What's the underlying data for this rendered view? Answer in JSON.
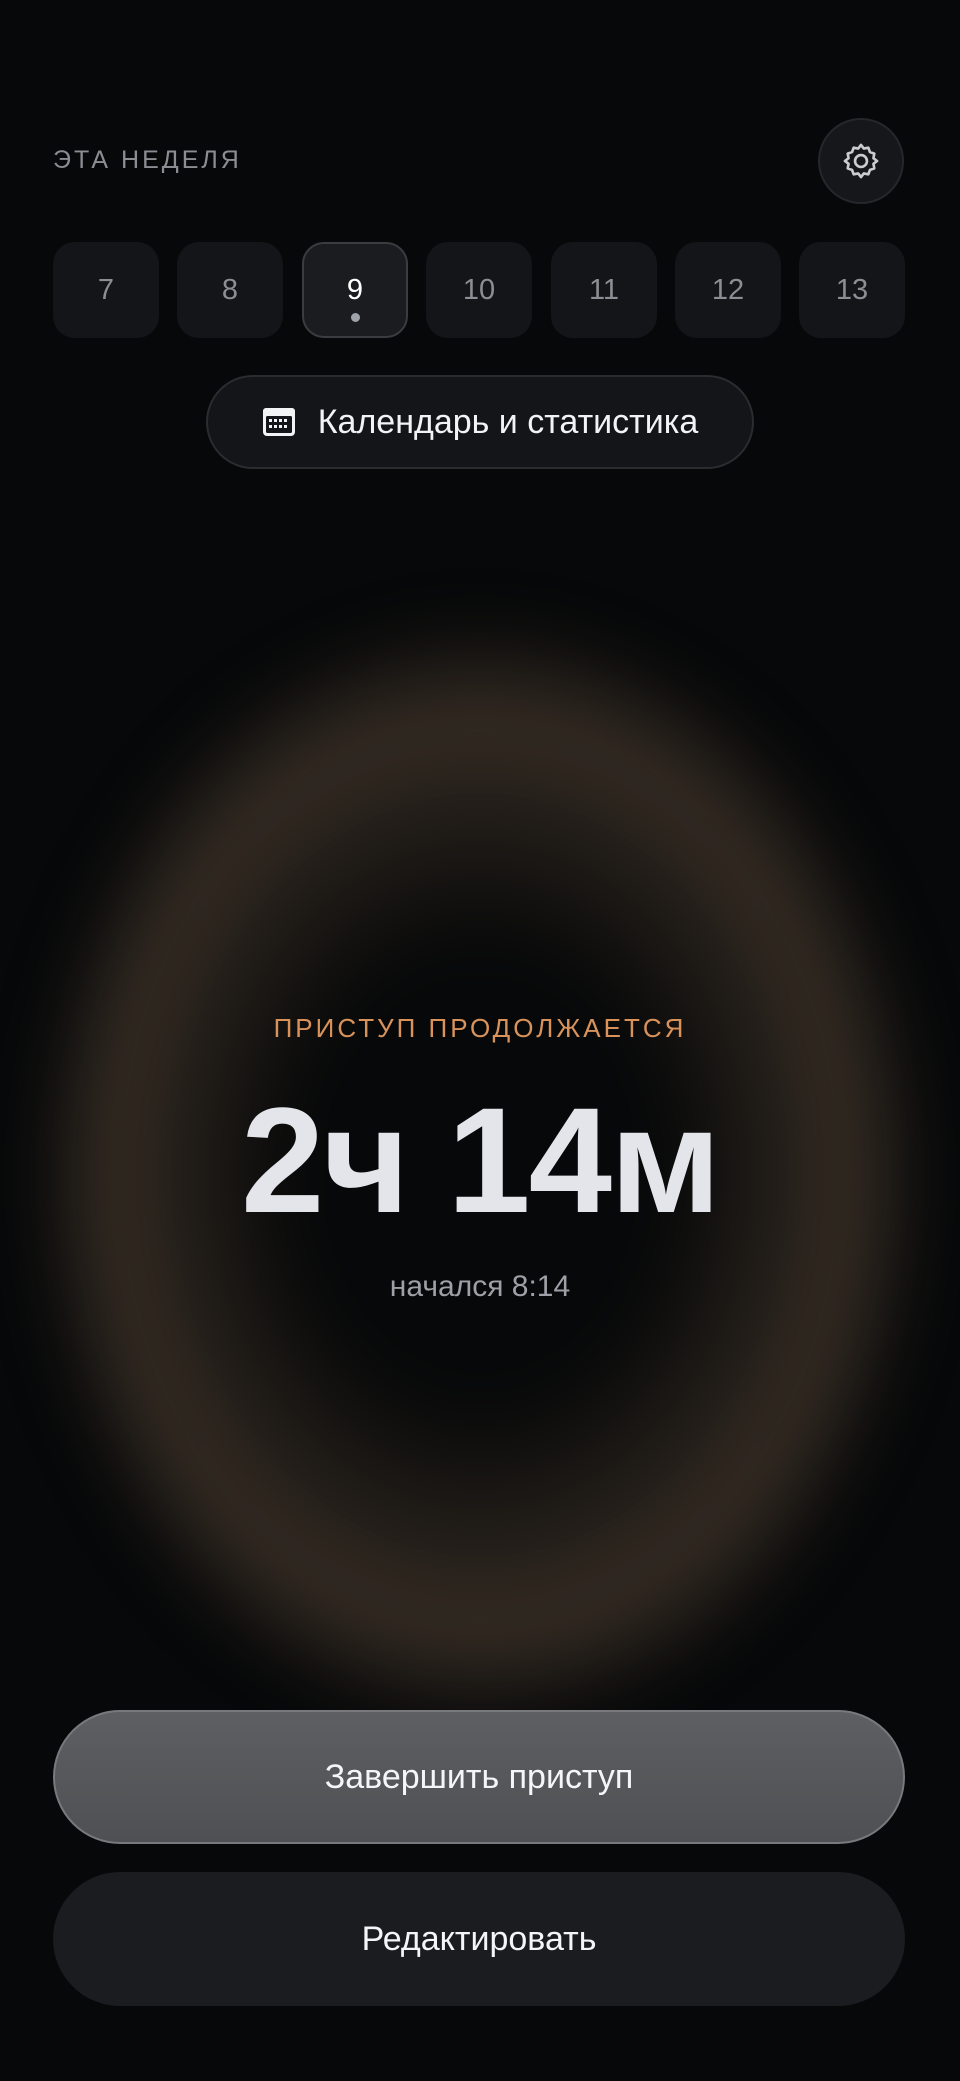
{
  "header": {
    "week_label": "ЭТА НЕДЕЛЯ",
    "settings_icon": "gear-icon"
  },
  "week": {
    "days": [
      "7",
      "8",
      "9",
      "10",
      "11",
      "12",
      "13"
    ],
    "selected_index": 2
  },
  "calendar_button": {
    "icon": "calendar-icon",
    "label": "Календарь и статистика"
  },
  "episode": {
    "status": "ПРИСТУП ПРОДОЛЖАЕТСЯ",
    "duration": "2ч 14м",
    "started": "начался 8:14"
  },
  "actions": {
    "end_label": "Завершить приступ",
    "edit_label": "Редактировать"
  },
  "colors": {
    "background": "#070809",
    "accent": "#d9935a",
    "primary_button": "#57585b",
    "secondary_button": "#1b1c1f"
  }
}
